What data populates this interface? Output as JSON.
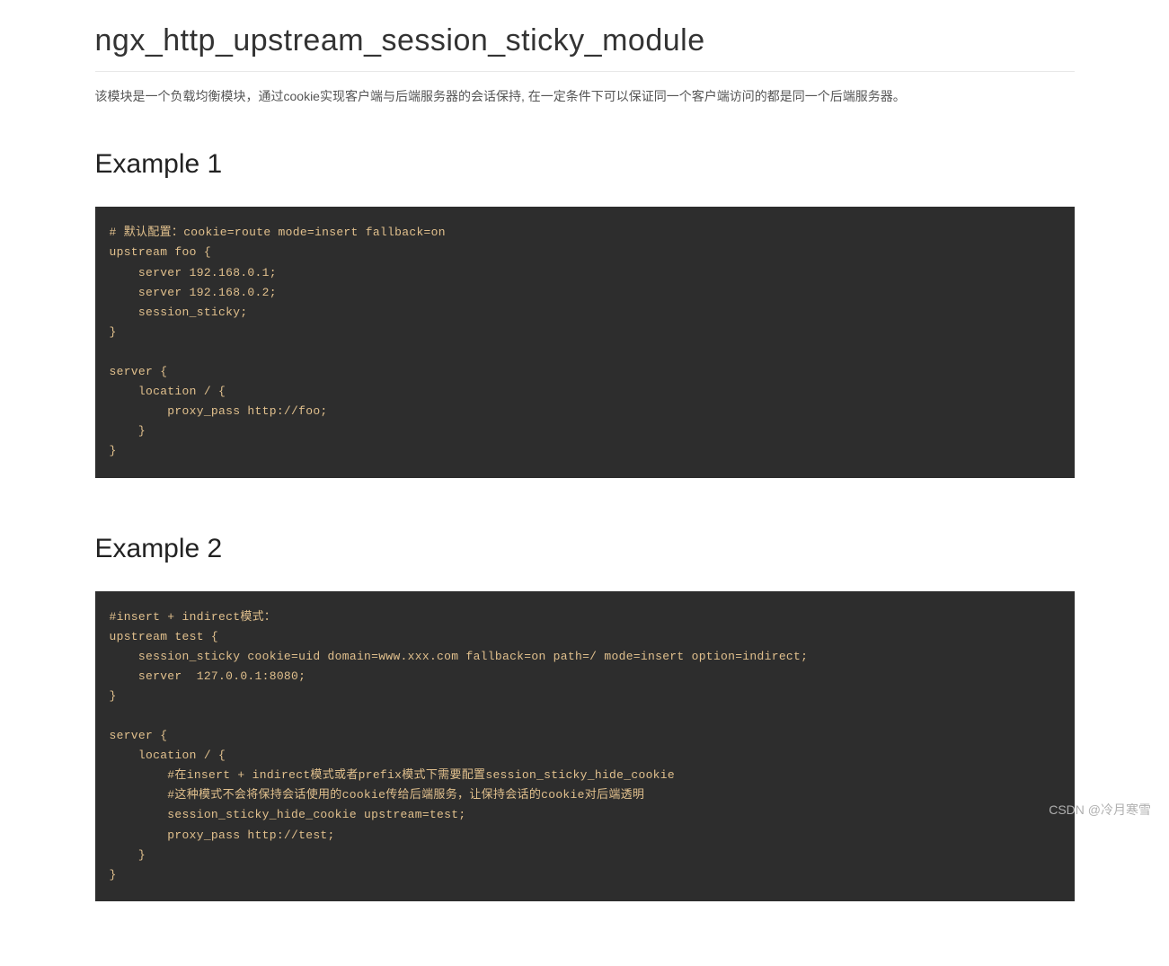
{
  "page": {
    "title": "ngx_http_upstream_session_sticky_module",
    "description": "该模块是一个负载均衡模块，通过cookie实现客户端与后端服务器的会话保持, 在一定条件下可以保证同一个客户端访问的都是同一个后端服务器。"
  },
  "sections": [
    {
      "heading": "Example 1",
      "code": "# 默认配置：cookie=route mode=insert fallback=on\nupstream foo {\n    server 192.168.0.1;\n    server 192.168.0.2;\n    session_sticky;\n}\n\nserver {\n    location / {\n        proxy_pass http://foo;\n    }\n}"
    },
    {
      "heading": "Example 2",
      "code": "#insert + indirect模式：\nupstream test {\n    session_sticky cookie=uid domain=www.xxx.com fallback=on path=/ mode=insert option=indirect;\n    server  127.0.0.1:8080;\n}\n\nserver {\n    location / {\n        #在insert + indirect模式或者prefix模式下需要配置session_sticky_hide_cookie\n        #这种模式不会将保持会话使用的cookie传给后端服务，让保持会话的cookie对后端透明\n        session_sticky_hide_cookie upstream=test;\n        proxy_pass http://test;\n    }\n}"
    }
  ],
  "watermark": "CSDN @冷月寒雪"
}
